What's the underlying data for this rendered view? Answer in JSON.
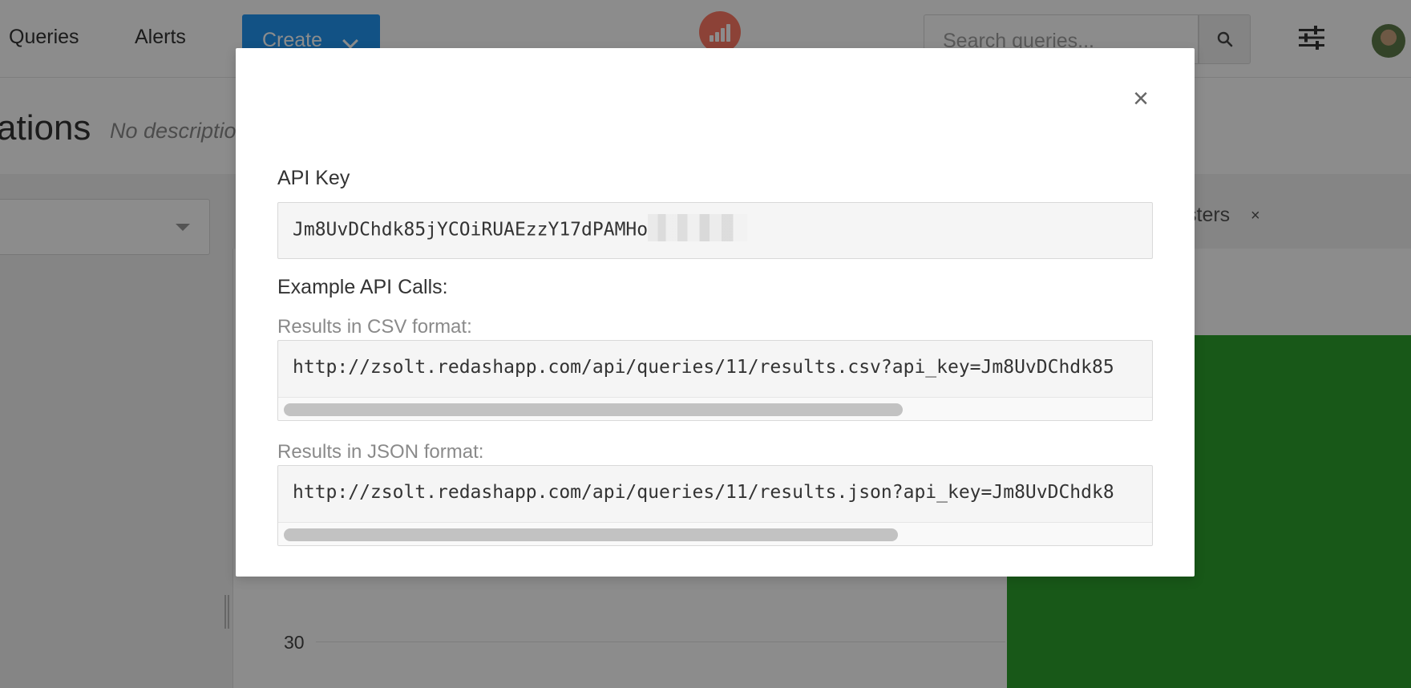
{
  "nav": {
    "queries": "Queries",
    "alerts": "Alerts",
    "create": "Create",
    "search_placeholder": "Search queries..."
  },
  "page": {
    "title": "ations",
    "description": "No descriptio"
  },
  "background": {
    "tag_label": "sters",
    "tag_close": "×",
    "axis_tick": "30",
    "bar_color": "#2ca02c"
  },
  "modal": {
    "close_symbol": "×",
    "api_key_label": "API Key",
    "api_key_value": "Jm8UvDChdk85jYCOiRUAEzzY17dPAMHo",
    "examples_heading": "Example API Calls:",
    "csv_label": "Results in CSV format:",
    "csv_url": "http://zsolt.redashapp.com/api/queries/11/results.csv?api_key=Jm8UvDChdk85",
    "json_label": "Results in JSON format:",
    "json_url": "http://zsolt.redashapp.com/api/queries/11/results.json?api_key=Jm8UvDChdk8"
  },
  "colors": {
    "accent": "#2196f3",
    "logo": "#ff7964"
  }
}
